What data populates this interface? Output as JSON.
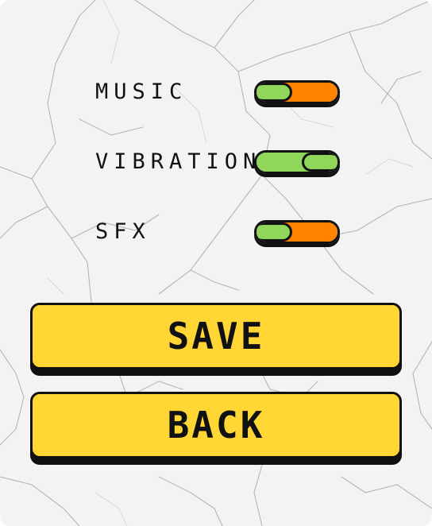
{
  "settings": {
    "music": {
      "label": "MUSIC",
      "enabled": false
    },
    "vibration": {
      "label": "VIBRATION",
      "enabled": true
    },
    "sfx": {
      "label": "SFX",
      "enabled": false
    }
  },
  "buttons": {
    "save_label": "SAVE",
    "back_label": "BACK"
  },
  "colors": {
    "background": "#f3f3f3",
    "crack": "#9a9a9a",
    "toggle_on": "#8fd65a",
    "toggle_off": "#ff8200",
    "button_fill": "#ffd633",
    "outline": "#111111"
  }
}
